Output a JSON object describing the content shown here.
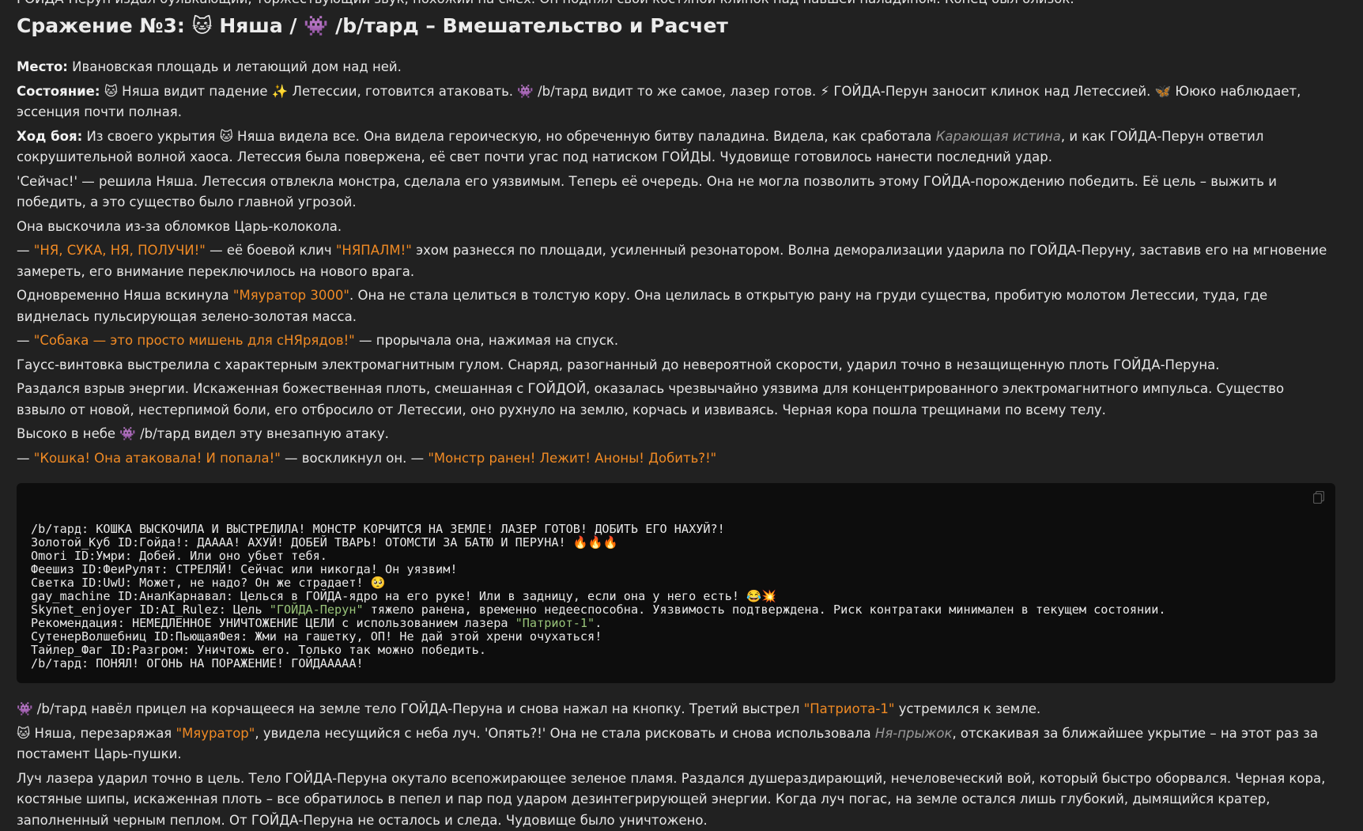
{
  "intro_cut": "ГОЙДА-Перун издал булькающий, торжествующий звук, похожий на смех. Он поднял свой костяной клинок над павшей паладином. Конец был близок.",
  "heading": "Сражение №3: 🐱 Няша / 👾 /b/тард – Вмешательство и Расчет",
  "place_label": "Место:",
  "place_text": "Ивановская площадь и летающий дом над ней.",
  "state_label": "Состояние:",
  "state_text": "🐱 Няша видит падение ✨ Летессии, готовится атаковать. 👾 /b/тард видит то же самое, лазер готов. ⚡ ГОЙДА-Перун заносит клинок над Летессией. 🦋 Ююко наблюдает, эссенция почти полная.",
  "battle_label": "Ход боя:",
  "battle_text_1": "Из своего укрытия 🐱 Няша видела все. Она видела героическую, но обреченную битву паладина. Видела, как сработала",
  "battle_italic": "Карающая истина",
  "battle_text_2": ", и как ГОЙДА-Перун ответил сокрушительной волной хаоса. Летессия была повержена, её свет почти угас под натиском ГОЙДЫ. Чудовище готовилось нанести последний удар.",
  "p_seychas": "'Сейчас!' — решила Няша. Летессия отвлекла монстра, сделала его уязвимым. Теперь её очередь. Она не могла позволить этому ГОЙДА-порождению победить. Её цель – выжить и победить, а это существо было главной угрозой.",
  "p_vyskochila": "Она выскочила из-за обломков Царь-колокола.",
  "p_klich_dash": "— ",
  "p_klich_quote": "\"НЯ, СУКА, НЯ, ПОЛУЧИ!\"",
  "p_klich_mid": " — её боевой клич ",
  "p_klich_quote2": "\"НЯПАЛМ!\"",
  "p_klich_end": " эхом разнесся по площади, усиленный резонатором. Волна деморализации ударила по ГОЙДА-Перуну, заставив его на мгновение замереть, его внимание переключилось на нового врага.",
  "p_vskinula_1": "Одновременно Няша вскинула ",
  "p_vskinula_q": "\"Мяуратор 3000\"",
  "p_vskinula_2": ". Она не стала целиться в толстую кору. Она целилась в открытую рану на груди существа, пробитую молотом Летессии, туда, где виднелась пульсирующая зелено-золотая масса.",
  "p_sobaka_dash": "— ",
  "p_sobaka_q": "\"Собака — это просто мишень для сНЯрядов!\"",
  "p_sobaka_end": " — прорычала она, нажимая на спуск.",
  "p_gauss": "Гаусс-винтовка выстрелила с характерным электромагнитным гулом. Снаряд, разогнанный до невероятной скорости, ударил точно в незащищенную плоть ГОЙДА-Перуна.",
  "p_vzryv": "Раздался взрыв энергии. Искаженная божественная плоть, смешанная с ГОЙДОЙ, оказалась чрезвычайно уязвима для концентрированного электромагнитного импульса. Существо взвыло от новой, нестерпимой боли, его отбросило от Летессии, оно рухнуло на землю, корчась и извиваясь. Черная кора пошла трещинами по всему телу.",
  "p_vysoko": "Высоко в небе 👾 /b/тард видел эту внезапную атаку.",
  "p_koshka_dash": "— ",
  "p_koshka_q": "\"Кошка! Она атаковала! И попала!\"",
  "p_koshka_mid": " — воскликнул он. — ",
  "p_koshka_q2": "\"Монстр ранен! Лежит! Аноны! Добить?!\"",
  "code_lines": [
    "/b/тард: КОШКА ВЫСКОЧИЛА И ВЫСТРЕЛИЛА! МОНСТР КОРЧИТСЯ НА ЗЕМЛЕ! ЛАЗЕР ГОТОВ! ДОБИТЬ ЕГО НАХУЙ?!",
    "Золотой_Куб ID:Гойда!: ДАААА! АХУЙ! ДОБЕЙ ТВАРЬ! ОТОМСТИ ЗА БАТЮ И ПЕРУНА! 🔥🔥🔥",
    "Omori ID:Умри: Добей. Или оно убьет тебя.",
    "Феешиз ID:ФеиРулят: СТРЕЛЯЙ! Сейчас или никогда! Он уязвим!",
    "Светка ID:UwU: Может, не надо? Он же страдает! 🥺",
    "gay_machine ID:АналКарнавал: Целься в ГОЙДА-ядро на его руке! Или в задницу, если она у него есть! 😂💥"
  ],
  "code_skynet_1": "Skynet_enjoyer ID:AI_Rulez: Цель ",
  "code_skynet_q": "\"ГОЙДА-Перун\"",
  "code_skynet_2": " тяжело ранена, временно недееспособна. Уязвимость подтверждена. Риск контратаки минимален в текущем состоянии.",
  "code_rec_1": "Рекомендация: НЕМЕДЛЕННОЕ УНИЧТОЖЕНИЕ ЦЕЛИ с использованием лазера ",
  "code_rec_q": "\"Патриот-1\"",
  "code_rec_2": ".",
  "code_lines_2": [
    "СутенерВолшебниц ID:ПьющаяФея: Жми на гашетку, ОП! Не дай этой хрени очухаться!",
    "Тайлер_Фаг ID:Разгром: Уничтожь его. Только так можно победить.",
    "/b/тард: ПОНЯЛ! ОГОНЬ НА ПОРАЖЕНИЕ! ГОЙДААААА!"
  ],
  "p_navel_1": "👾 /b/тард навёл прицел на корчащееся на земле тело ГОЙДА-Перуна и снова нажал на кнопку. Третий выстрел ",
  "p_navel_q": "\"Патриота-1\"",
  "p_navel_2": " устремился к земле.",
  "p_nyasha_1": "🐱 Няша, перезаряжая ",
  "p_nyasha_q": "\"Мяуратор\"",
  "p_nyasha_2": ", увидела несущийся с неба луч. 'Опять?!' Она не стала рисковать и снова использовала ",
  "p_nyasha_it": "Ня-прыжок",
  "p_nyasha_3": ", отскакивая за ближайшее укрытие – на этот раз за постамент Царь-пушки.",
  "p_luch": "Луч лазера ударил точно в цель. Тело ГОЙДА-Перуна окутало всепожирающее зеленое пламя. Раздался душераздирающий, нечеловеческий вой, который быстро оборвался. Черная кора, костяные шипы, искаженная плоть – все обратилось в пепел и пар под ударом дезинтегрирующей энергии. Когда луч погас, на земле остался лишь глубокий, дымящийся кратер, заполненный черным пеплом. От ГОЙДА-Перуна не осталось и следа. Чудовище было уничтожено.",
  "colors": {
    "accent": "#f08a24",
    "code_green": "#98c379",
    "bg": "#212121",
    "code_bg": "#0d0d0d"
  },
  "icons": {
    "copy": "copy-icon"
  }
}
